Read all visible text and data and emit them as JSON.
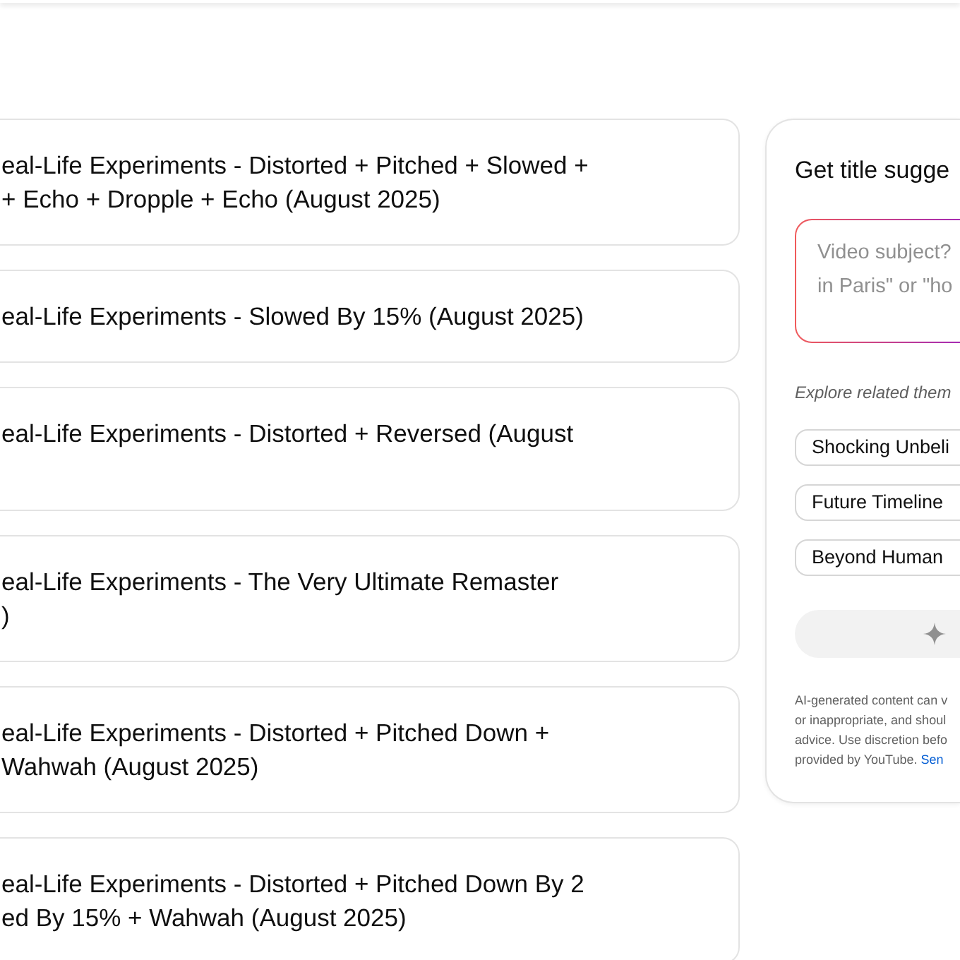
{
  "videos": [
    {
      "kind": "double",
      "lines": [
        "eal-Life Experiments - Distorted + Pitched + Slowed +",
        "+ Echo + Dropple + Echo (August 2025)"
      ]
    },
    {
      "kind": "single",
      "lines": [
        "eal-Life Experiments - Slowed By 15% (August 2025)"
      ]
    },
    {
      "kind": "double",
      "lines": [
        "eal-Life Experiments - Distorted + Reversed (August"
      ]
    },
    {
      "kind": "double",
      "lines": [
        "eal-Life Experiments - The Very Ultimate Remaster",
        ")"
      ]
    },
    {
      "kind": "double",
      "lines": [
        "eal-Life Experiments - Distorted + Pitched Down +",
        "Wahwah (August 2025)"
      ]
    },
    {
      "kind": "double",
      "lines": [
        "eal-Life Experiments - Distorted + Pitched Down By 2",
        "ed By 15% + Wahwah (August 2025)"
      ]
    }
  ],
  "panel": {
    "title": "Get title sugge",
    "input": {
      "placeholder": "Video subject?\nin Paris\" or \"ho"
    },
    "themes_label": "Explore related them",
    "themes": [
      "Shocking Unbeli",
      "Future Timeline",
      "Beyond Human"
    ],
    "disclaimer": {
      "lines": [
        "AI-generated content can v",
        "or inappropriate, and shoul",
        "advice. Use discretion befo",
        "provided by YouTube."
      ],
      "link": "Sen"
    }
  }
}
